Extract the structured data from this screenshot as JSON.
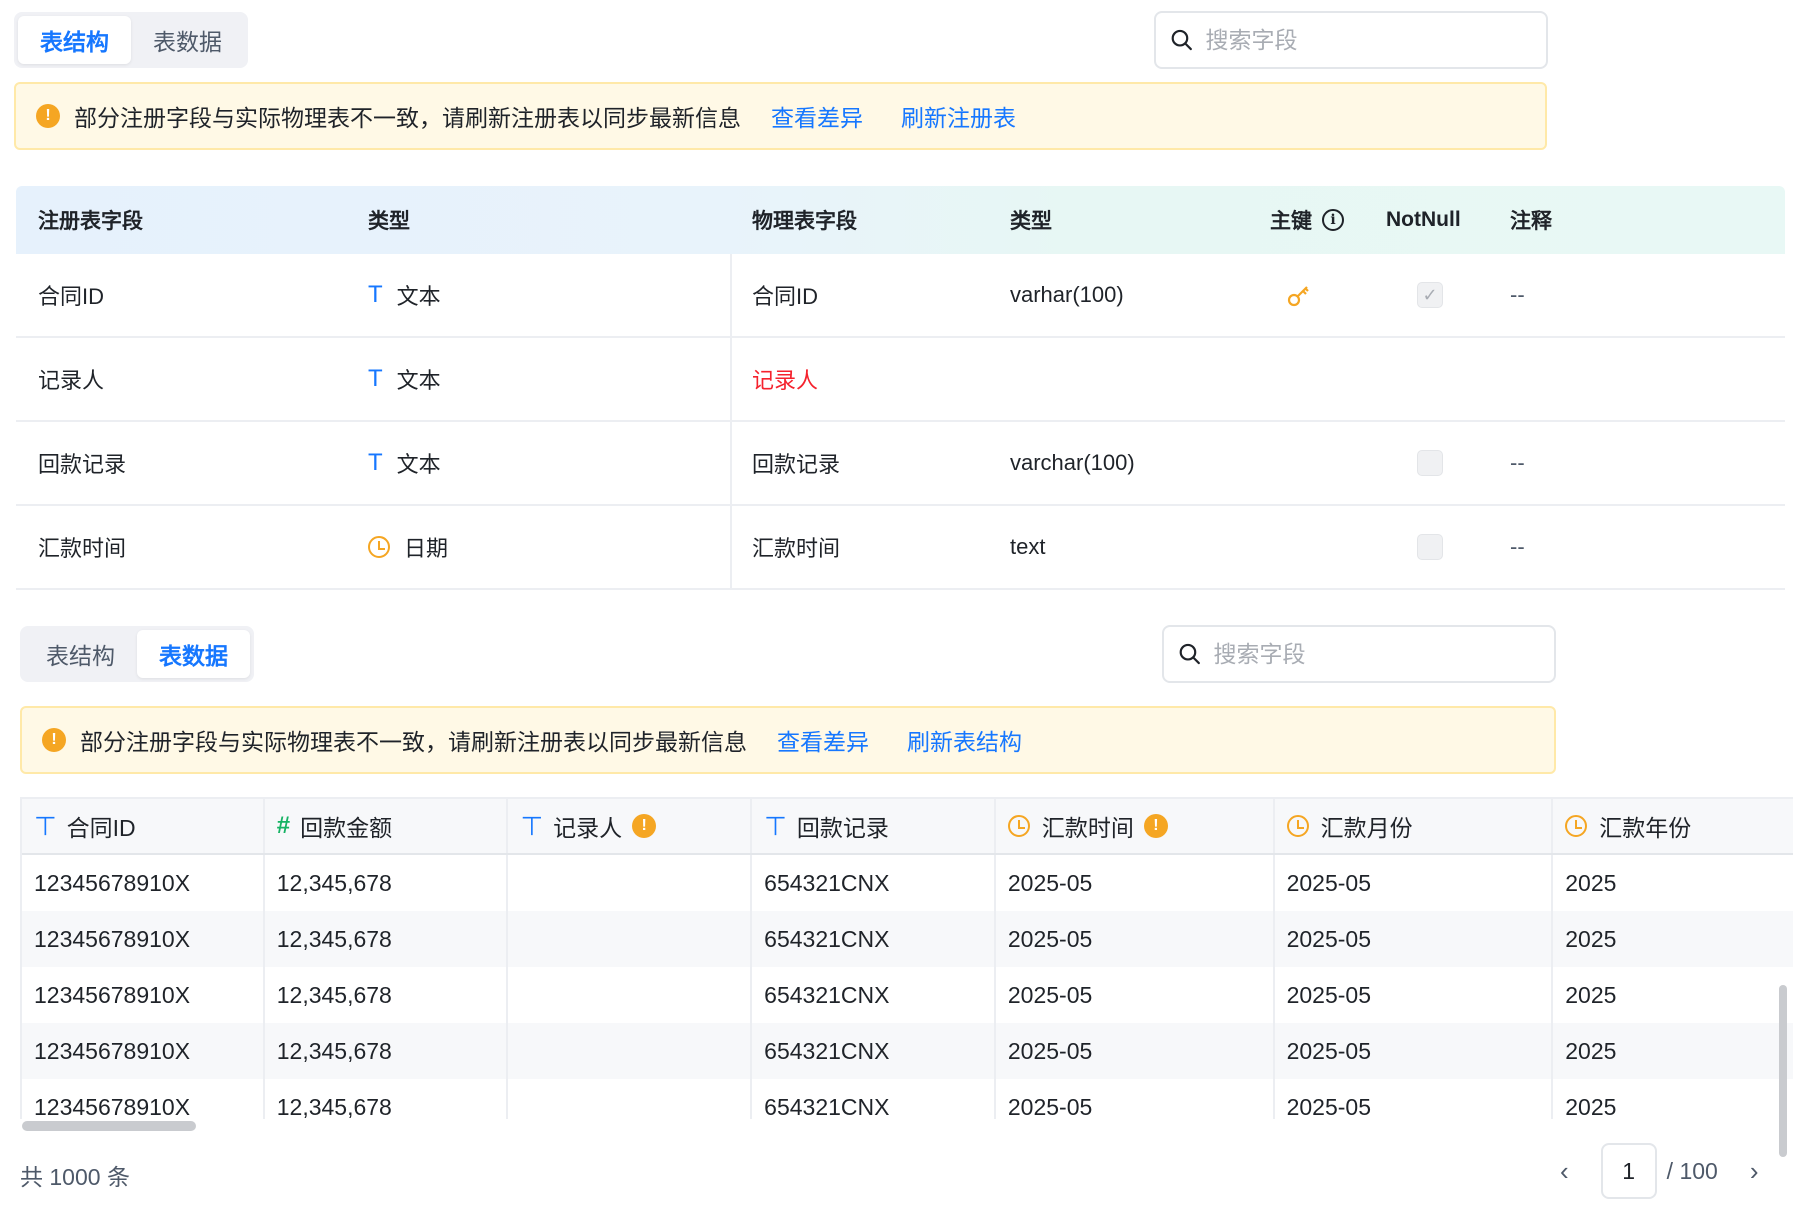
{
  "top": {
    "tabs": [
      {
        "label": "表结构"
      },
      {
        "label": "表数据"
      }
    ],
    "search_placeholder": "搜索字段",
    "alert": {
      "icon": "!",
      "message": "部分注册字段与实际物理表不一致，请刷新注册表以同步最新信息",
      "link1": "查看差异",
      "link2": "刷新注册表"
    },
    "headers": {
      "reg_field": "注册表字段",
      "reg_type": "类型",
      "phys_field": "物理表字段",
      "phys_type": "类型",
      "pk": "主键",
      "notnull": "NotNull",
      "comment": "注释"
    },
    "rows": [
      {
        "reg_field": "合同ID",
        "type_icon": "T",
        "reg_type": "文本",
        "phys_field": "合同ID",
        "phys_type": "varhar(100)",
        "pk": true,
        "notnull": true,
        "comment": "--"
      },
      {
        "reg_field": "记录人",
        "type_icon": "T",
        "reg_type": "文本",
        "phys_field": "记录人",
        "phys_type": "",
        "pk": false,
        "notnull": null,
        "comment": ""
      },
      {
        "reg_field": "回款记录",
        "type_icon": "T",
        "reg_type": "文本",
        "phys_field": "回款记录",
        "phys_type": "varchar(100)",
        "pk": false,
        "notnull": false,
        "comment": "--"
      },
      {
        "reg_field": "汇款时间",
        "type_icon": "clock",
        "reg_type": "日期",
        "phys_field": "汇款时间",
        "phys_type": "text",
        "pk": false,
        "notnull": false,
        "comment": "--"
      }
    ]
  },
  "bottom": {
    "tabs": [
      {
        "label": "表结构"
      },
      {
        "label": "表数据"
      }
    ],
    "search_placeholder": "搜索字段",
    "alert": {
      "icon": "!",
      "message": "部分注册字段与实际物理表不一致，请刷新注册表以同步最新信息",
      "link1": "查看差异",
      "link2": "刷新表结构"
    },
    "columns": [
      {
        "icon": "text-icon",
        "label": "合同ID",
        "warn": false
      },
      {
        "icon": "number-icon",
        "label": "回款金额",
        "warn": false
      },
      {
        "icon": "text-icon",
        "label": "记录人",
        "warn": true
      },
      {
        "icon": "text-icon",
        "label": "回款记录",
        "warn": false
      },
      {
        "icon": "clock-icon",
        "label": "汇款时间",
        "warn": true
      },
      {
        "icon": "clock-icon",
        "label": "汇款月份",
        "warn": false
      },
      {
        "icon": "clock-icon",
        "label": "汇款年份",
        "warn": false
      }
    ],
    "rows": [
      [
        "12345678910X",
        "12,345,678",
        "",
        "654321CNX",
        "2025-05",
        "2025-05",
        "2025"
      ],
      [
        "12345678910X",
        "12,345,678",
        "",
        "654321CNX",
        "2025-05",
        "2025-05",
        "2025"
      ],
      [
        "12345678910X",
        "12,345,678",
        "",
        "654321CNX",
        "2025-05",
        "2025-05",
        "2025"
      ],
      [
        "12345678910X",
        "12,345,678",
        "",
        "654321CNX",
        "2025-05",
        "2025-05",
        "2025"
      ],
      [
        "12345678910X",
        "12,345,678",
        "",
        "654321CNX",
        "2025-05",
        "2025-05",
        "2025"
      ]
    ],
    "total": "共 1000 条",
    "page": "1",
    "page_total": "/ 100",
    "prev": "‹",
    "next": "›"
  },
  "colors": {
    "accent": "#1677ff",
    "warning": "#f5a623",
    "danger": "#f5222d",
    "number": "#16b364"
  }
}
